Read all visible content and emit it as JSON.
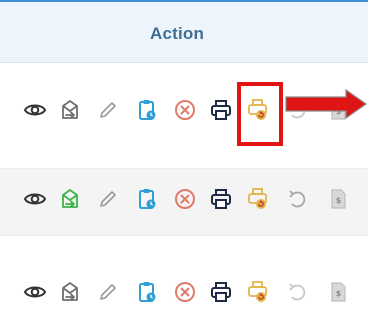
{
  "header": {
    "title": "Action"
  },
  "rows": [
    {
      "icons": [
        "eye-icon",
        "mail-send-icon",
        "pencil-icon",
        "clipboard-clock-icon",
        "cancel-icon",
        "printer-icon",
        "reprint-icon",
        "undo-icon",
        "document-dollar-icon"
      ]
    },
    {
      "icons": [
        "eye-icon",
        "mail-send-icon",
        "pencil-icon",
        "clipboard-clock-icon",
        "cancel-icon",
        "printer-icon",
        "reprint-icon",
        "undo-icon",
        "document-dollar-icon"
      ]
    },
    {
      "icons": [
        "eye-icon",
        "mail-send-icon",
        "pencil-icon",
        "clipboard-clock-icon",
        "cancel-icon",
        "printer-icon",
        "reprint-icon",
        "undo-icon",
        "document-dollar-icon"
      ]
    }
  ],
  "colors": {
    "header_bg": "#eef4fb",
    "header_text": "#3f6f96",
    "icon_gray": "#6f6f6f",
    "clipboard_blue": "#2f9fd8",
    "cancel_red": "#e07a6a",
    "printer_dark": "#1f2a44",
    "reprint_amber": "#e3b54a",
    "mail_green": "#3db34a",
    "highlight_red": "#e01414"
  },
  "annotation": {
    "highlighted_icon": "reprint-icon",
    "pointer": "red-arrow"
  }
}
